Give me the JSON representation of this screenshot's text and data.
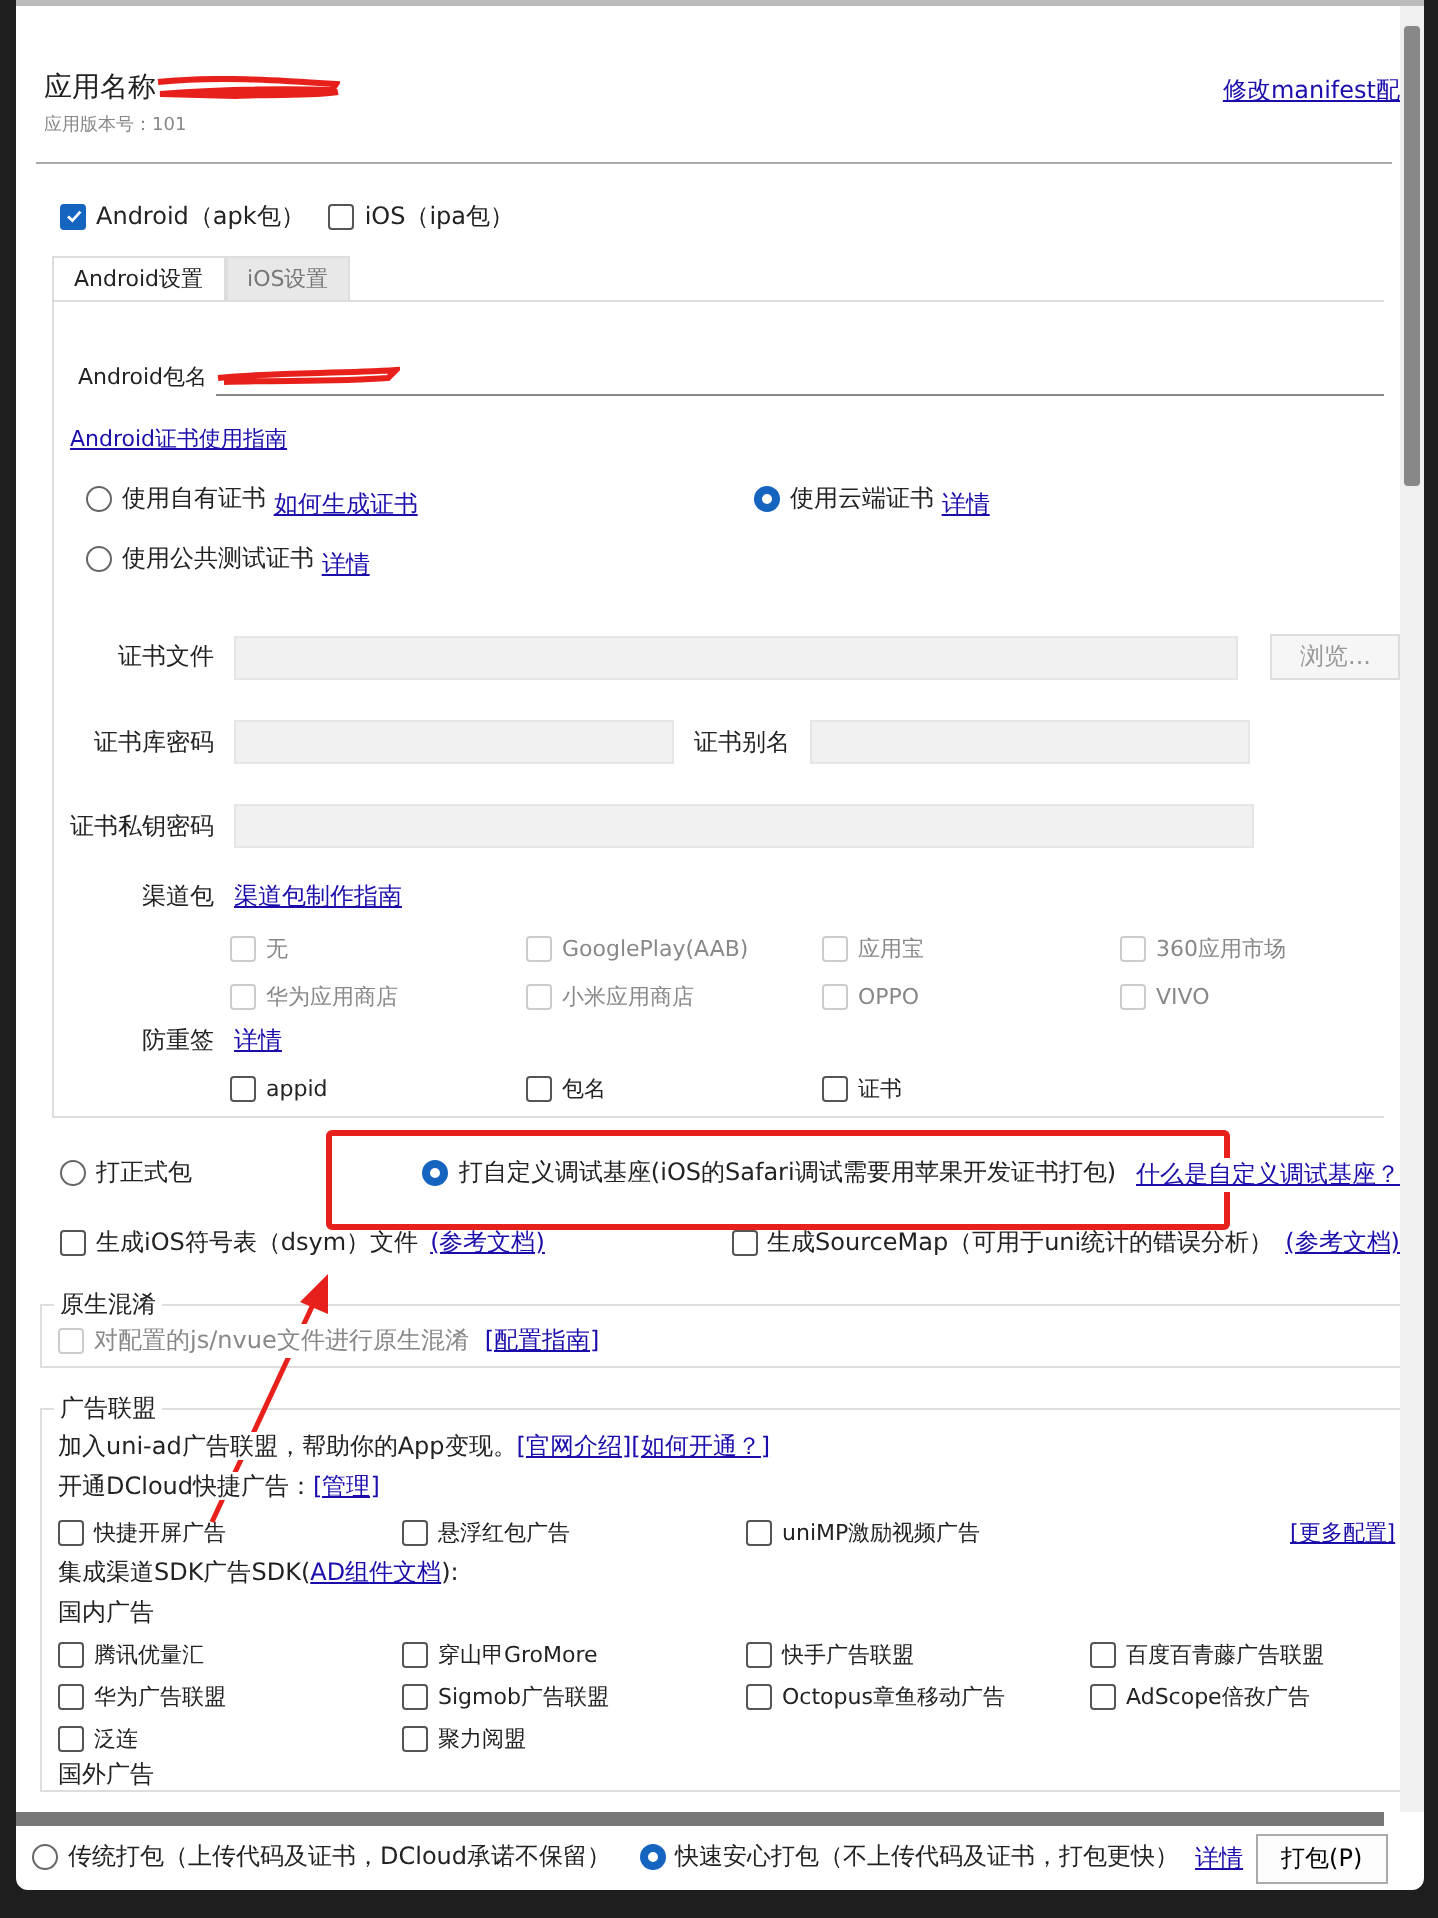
{
  "header": {
    "app_name_label": "应用名称",
    "version": "应用版本号：101",
    "manifest_link": "修改manifest配"
  },
  "platforms": [
    {
      "label": "Android（apk包）",
      "checked": true
    },
    {
      "label": "iOS（ipa包）",
      "checked": false
    }
  ],
  "tabs": [
    {
      "label": "Android设置",
      "selected": true
    },
    {
      "label": "iOS设置",
      "selected": false
    }
  ],
  "android": {
    "package_label": "Android包名",
    "cert_guide_link": "Android证书使用指南",
    "cert_options": [
      {
        "label": "使用自有证书",
        "link": "如何生成证书",
        "selected": false
      },
      {
        "label": "使用云端证书",
        "link": "详情",
        "selected": true
      },
      {
        "label": "使用公共测试证书",
        "link": "详情",
        "selected": false
      }
    ],
    "cert_file_label": "证书文件",
    "browse_button": "浏览...",
    "keystore_password_label": "证书库密码",
    "alias_label": "证书别名",
    "key_password_label": "证书私钥密码",
    "channel": {
      "label": "渠道包",
      "link": "渠道包制作指南",
      "options": [
        {
          "label": "无",
          "checked": false,
          "disabled": true
        },
        {
          "label": "GooglePlay(AAB)",
          "checked": false,
          "disabled": true
        },
        {
          "label": "应用宝",
          "checked": false,
          "disabled": true
        },
        {
          "label": "360应用市场",
          "checked": false,
          "disabled": true
        },
        {
          "label": "华为应用商店",
          "checked": false,
          "disabled": true
        },
        {
          "label": "小米应用商店",
          "checked": false,
          "disabled": true
        },
        {
          "label": "OPPO",
          "checked": false,
          "disabled": true
        },
        {
          "label": "VIVO",
          "checked": false,
          "disabled": true
        }
      ]
    },
    "resign": {
      "label": "防重签",
      "link": "详情",
      "options": [
        {
          "label": "appid",
          "checked": false
        },
        {
          "label": "包名",
          "checked": false
        },
        {
          "label": "证书",
          "checked": false
        }
      ]
    }
  },
  "build_type": [
    {
      "label": "打正式包",
      "selected": false
    },
    {
      "label": "打自定义调试基座(iOS的Safari调试需要用苹果开发证书打包)",
      "selected": true
    }
  ],
  "build_type_link": "什么是自定义调试基座？",
  "extras": [
    {
      "label": "生成iOS符号表（dsym）文件",
      "link": "(参考文档)",
      "checked": false
    },
    {
      "label": "生成SourceMap（可用于uni统计的错误分析）",
      "link": "(参考文档)",
      "checked": false
    }
  ],
  "obfuscation": {
    "title": "原生混淆",
    "label": "对配置的js/nvue文件进行原生混淆",
    "checked": false,
    "disabled": true,
    "link": "[配置指南]"
  },
  "ads": {
    "title": "广告联盟",
    "intro": "加入uni-ad广告联盟，帮助你的App变现。",
    "intro_links": [
      "[官网介绍]",
      "[如何开通？]"
    ],
    "quick_label": "开通DCloud快捷广告：",
    "quick_link": "[管理]",
    "quick_options": [
      {
        "label": "快捷开屏广告",
        "checked": false
      },
      {
        "label": "悬浮红包广告",
        "checked": false
      },
      {
        "label": "uniMP激励视频广告",
        "checked": false
      }
    ],
    "more_link": "[更多配置]",
    "sdk_prefix": "集成渠道SDK广告SDK(",
    "sdk_link": "AD组件文档",
    "sdk_suffix": "):",
    "domestic_title": "国内广告",
    "domestic": [
      {
        "label": "腾讯优量汇",
        "checked": false
      },
      {
        "label": "穿山甲GroMore",
        "checked": false
      },
      {
        "label": "快手广告联盟",
        "checked": false
      },
      {
        "label": "百度百青藤广告联盟",
        "checked": false
      },
      {
        "label": "华为广告联盟",
        "checked": false
      },
      {
        "label": "Sigmob广告联盟",
        "checked": false
      },
      {
        "label": "Octopus章鱼移动广告",
        "checked": false
      },
      {
        "label": "AdScope倍孜广告",
        "checked": false
      },
      {
        "label": "泛连",
        "checked": false
      },
      {
        "label": "聚力阅盟",
        "checked": false
      }
    ],
    "overseas_title": "国外广告"
  },
  "pack_mode": [
    {
      "label": "传统打包（上传代码及证书，DCloud承诺不保留）",
      "selected": false
    },
    {
      "label": "快速安心打包（不上传代码及证书，打包更快）",
      "selected": true
    }
  ],
  "pack_mode_link": "详情",
  "pack_button": "打包(P)"
}
